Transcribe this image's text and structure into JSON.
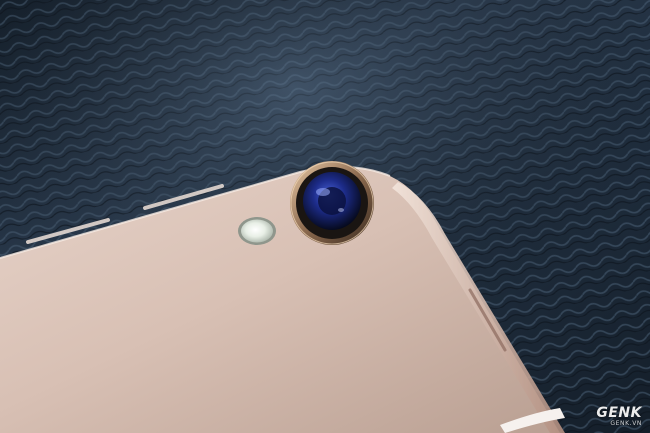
{
  "watermark": {
    "brand": "GENK",
    "domain": "GENK.VN"
  },
  "colors": {
    "background": "#1c2a38",
    "device_body": "#d9c2b6",
    "lens": "#1d2c8a",
    "flash": "#e8efe6"
  },
  "icons": {
    "brand": "lightning-g-logo"
  }
}
